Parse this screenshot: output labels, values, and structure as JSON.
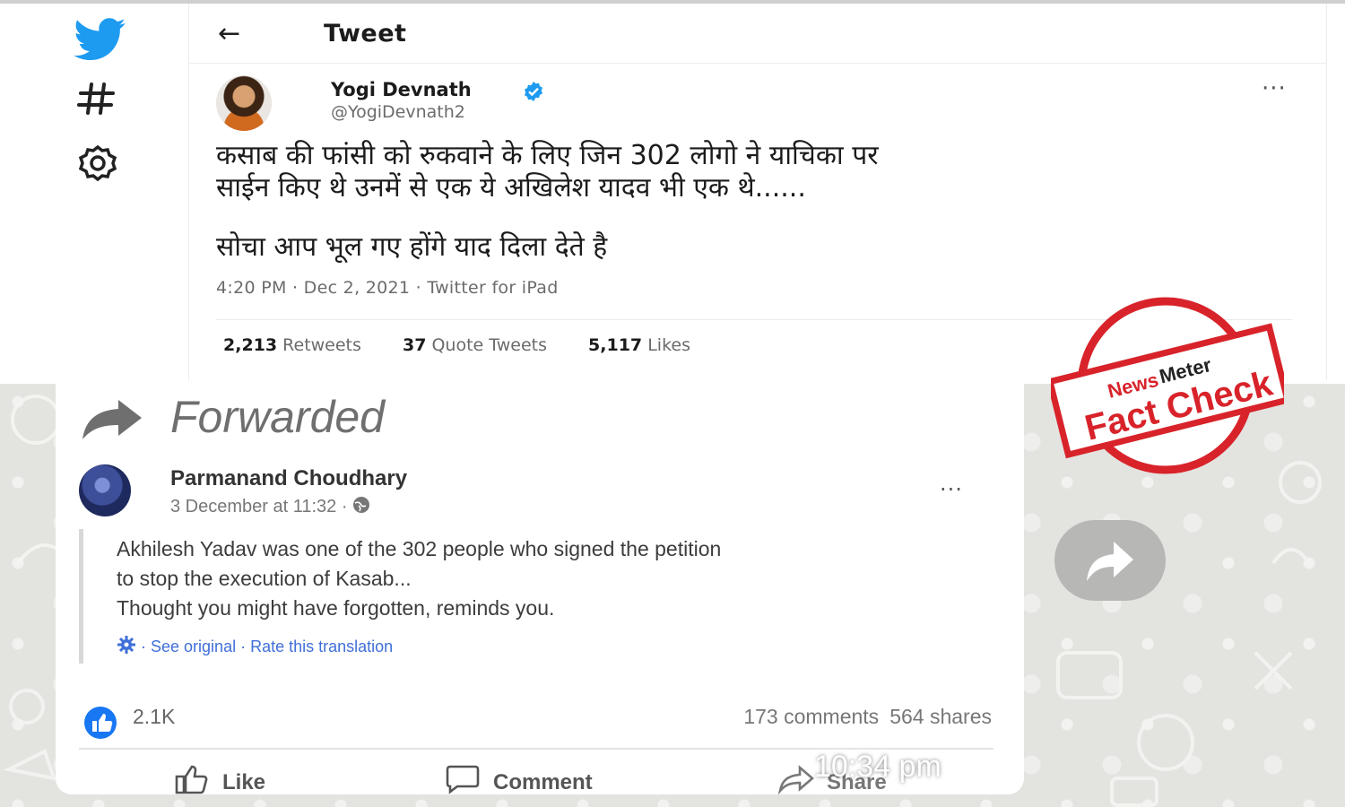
{
  "twitter": {
    "header_title": "Tweet",
    "author_name": "Yogi Devnath",
    "author_handle": "@YogiDevnath2",
    "tweet_lines": [
      "कसाब की फांसी को रुकवाने के लिए जिन 302 लोगो ने याचिका पर",
      "साईन किए थे उनमें से एक ये अखिलेश यादव भी एक थे......",
      "सोचा आप भूल गए होंगे याद दिला देते है"
    ],
    "timestamp": "4:20 PM · Dec 2, 2021 · Twitter for iPad",
    "stats": [
      {
        "count": "2,213",
        "label": "Retweets"
      },
      {
        "count": "37",
        "label": "Quote Tweets"
      },
      {
        "count": "5,117",
        "label": "Likes"
      }
    ],
    "more": "···",
    "brand_color": "#1d9bf0",
    "nav_icons": [
      "twitter-bird-icon",
      "hashtag-icon",
      "gear-icon"
    ]
  },
  "whatsapp": {
    "forwarded_label": "Forwarded",
    "time": "10:34 pm",
    "fb_post": {
      "author": "Parmanand Choudhary",
      "date": "3 December at 11:32 ·",
      "body_lines": [
        "Akhilesh Yadav was one of the 302 people who signed the petition",
        "to stop the execution of Kasab...",
        "Thought you might have forgotten, reminds you."
      ],
      "translate_links": "· See original · Rate this translation",
      "reactions": "2.1K",
      "comments": "173 comments",
      "shares": "564 shares",
      "more": "···",
      "actions": {
        "like": "Like",
        "comment": "Comment",
        "share": "Share"
      },
      "link_color": "#3f6fd8"
    }
  },
  "stamp": {
    "line1": "News",
    "line1b": "Meter",
    "line2": "Fact Check",
    "color": "#d8232a"
  }
}
